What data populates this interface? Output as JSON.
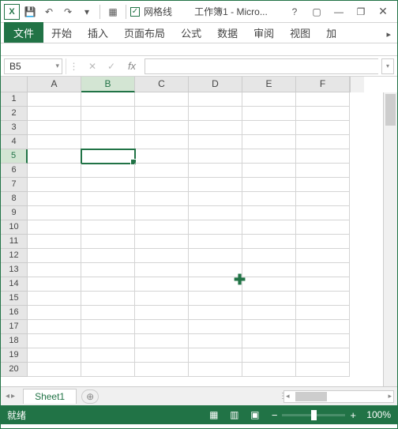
{
  "titlebar": {
    "app_abbrev": "X",
    "gridlines_checked": "✓",
    "gridlines_label": "网格线",
    "title": "工作簿1 - Micro...",
    "help": "?",
    "ribbon_opts": "▢",
    "minimize": "—",
    "restore": "❐",
    "close": "✕"
  },
  "qat": {
    "save": "💾",
    "undo": "↶",
    "redo": "↷",
    "dropdown": "▾",
    "border": "▦"
  },
  "ribbon": {
    "file": "文件",
    "tabs": [
      "开始",
      "插入",
      "页面布局",
      "公式",
      "数据",
      "审阅",
      "视图",
      "加"
    ],
    "collapse": "▸"
  },
  "formula_bar": {
    "name_box": "B5",
    "cancel": "✕",
    "accept": "✓",
    "fx": "fx",
    "formula": "",
    "expand": "▾"
  },
  "grid": {
    "columns": [
      "A",
      "B",
      "C",
      "D",
      "E",
      "F"
    ],
    "rows": [
      "1",
      "2",
      "3",
      "4",
      "5",
      "6",
      "7",
      "8",
      "9",
      "10",
      "11",
      "12",
      "13",
      "14",
      "15",
      "16",
      "17",
      "18",
      "19",
      "20"
    ],
    "active_col": "B",
    "active_row": "5"
  },
  "sheets": {
    "nav_prev": "◂",
    "nav_next": "▸",
    "tab1": "Sheet1",
    "add": "⊕",
    "split": "⋮"
  },
  "statusbar": {
    "ready": "就绪",
    "view_normal": "▦",
    "view_layout": "▥",
    "view_break": "▣",
    "zoom_minus": "−",
    "zoom_plus": "+",
    "zoom_pct": "100%"
  }
}
